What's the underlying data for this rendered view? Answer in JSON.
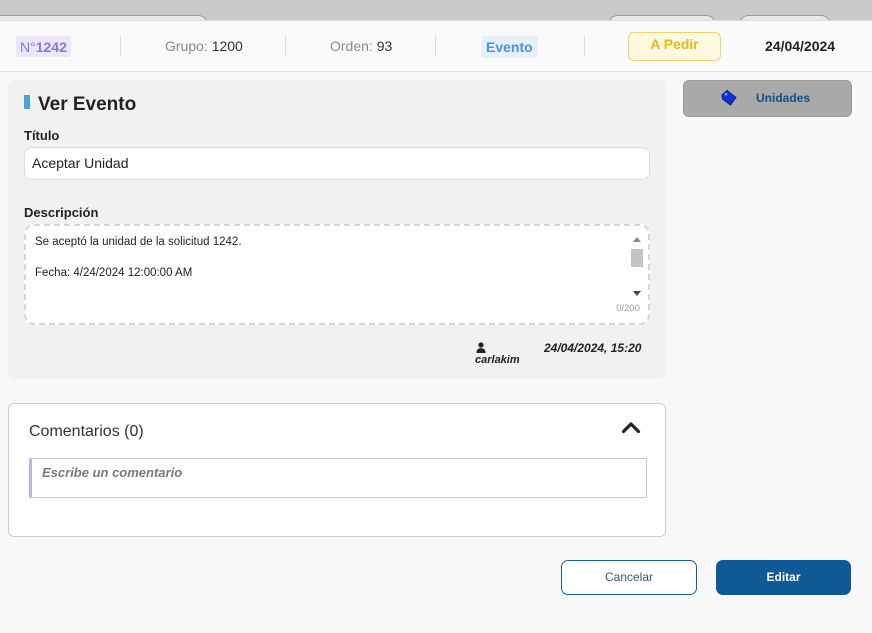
{
  "header": {
    "number_prefix": "N°",
    "number": "1242",
    "group_label": "Grupo:",
    "group_value": "1200",
    "order_label": "Orden:",
    "order_value": "93",
    "type_badge": "Evento",
    "status": "A Pedir",
    "date": "24/04/2024"
  },
  "event": {
    "heading": "Ver Evento",
    "title_label": "Título",
    "title_value": "Aceptar Unidad",
    "description_label": "Descripción",
    "description_value": "Se aceptó la unidad de la solicitud 1242.\n\nFecha: 4/24/2024 12:00:00 AM",
    "char_counter": "0/200",
    "author": "carlakim",
    "timestamp": "24/04/2024, 15:20"
  },
  "side": {
    "units_label": "Unidades"
  },
  "comments": {
    "title": "Comentarios (0)",
    "placeholder": "Escribe un comentario"
  },
  "footer": {
    "cancel_label": "Cancelar",
    "edit_label": "Editar"
  },
  "colors": {
    "accent": "#0e5a96",
    "status_yellow": "#e5b81c",
    "number_purple": "#8a76d6",
    "event_blue": "#4f93d6"
  },
  "icons": [
    "user-icon",
    "tag-icon",
    "chevron-up-icon",
    "scroll-up-icon",
    "scroll-down-icon"
  ]
}
